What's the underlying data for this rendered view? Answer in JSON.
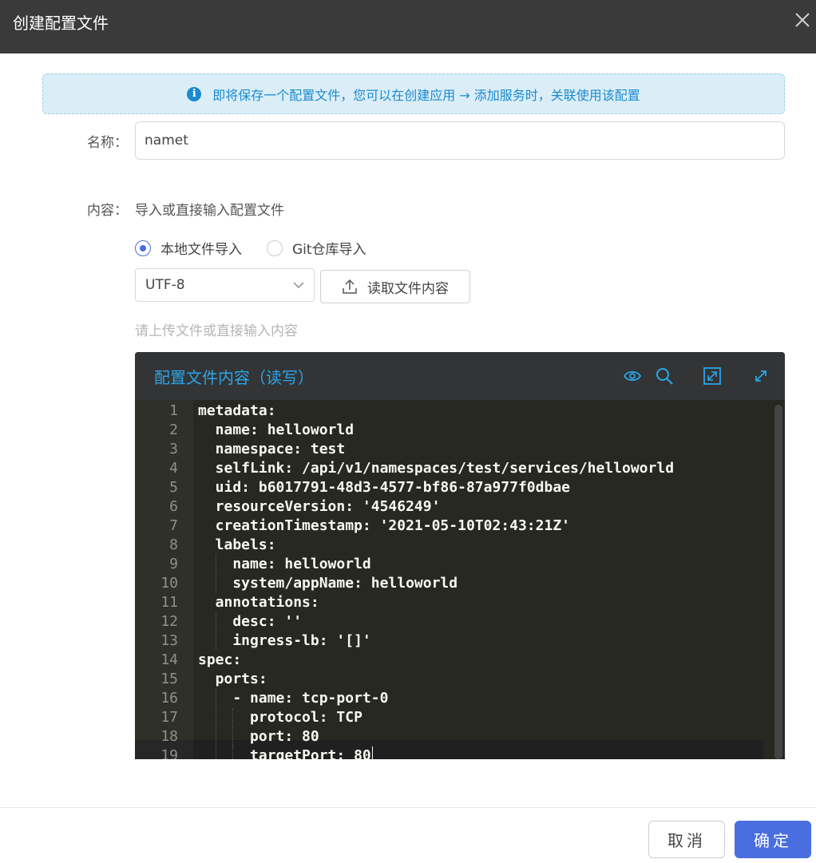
{
  "dialog": {
    "title": "创建配置文件"
  },
  "notice": {
    "text": "即将保存一个配置文件，您可以在创建应用 → 添加服务时，关联使用该配置"
  },
  "form": {
    "name_label": "名称：",
    "name_value": "namet",
    "content_label": "内容：",
    "content_hint": "导入或直接输入配置文件",
    "radio_local": "本地文件导入",
    "radio_git": "Git仓库导入",
    "radio_selected": "local",
    "encoding": "UTF-8",
    "read_button": "读取文件内容",
    "upload_placeholder": "请上传文件或直接输入内容"
  },
  "editor": {
    "title": "配置文件内容（读写）",
    "icons": [
      "eye-icon",
      "search-icon",
      "expand-icon",
      "fullscreen-icon"
    ],
    "lines": [
      "metadata:",
      "  name: helloworld",
      "  namespace: test",
      "  selfLink: /api/v1/namespaces/test/services/helloworld",
      "  uid: b6017791-48d3-4577-bf86-87a977f0dbae",
      "  resourceVersion: '4546249'",
      "  creationTimestamp: '2021-05-10T02:43:21Z'",
      "  labels:",
      "    name: helloworld",
      "    system/appName: helloworld",
      "  annotations:",
      "    desc: ''",
      "    ingress-lb: '[]'",
      "spec:",
      "  ports:",
      "    - name: tcp-port-0",
      "      protocol: TCP",
      "      port: 80",
      "      targetPort: 80"
    ],
    "line_numbers": [
      "1",
      "2",
      "3",
      "4",
      "5",
      "6",
      "7",
      "8",
      "9",
      "10",
      "11",
      "12",
      "13",
      "14",
      "15",
      "16",
      "17",
      "18",
      "19"
    ]
  },
  "footer": {
    "cancel": "取消",
    "ok": "确定"
  },
  "colors": {
    "accent": "#4a6ee0",
    "header_bg": "#3a3a3a",
    "editor_title": "#2aa6e8",
    "notice_text": "#1a8ad1"
  }
}
